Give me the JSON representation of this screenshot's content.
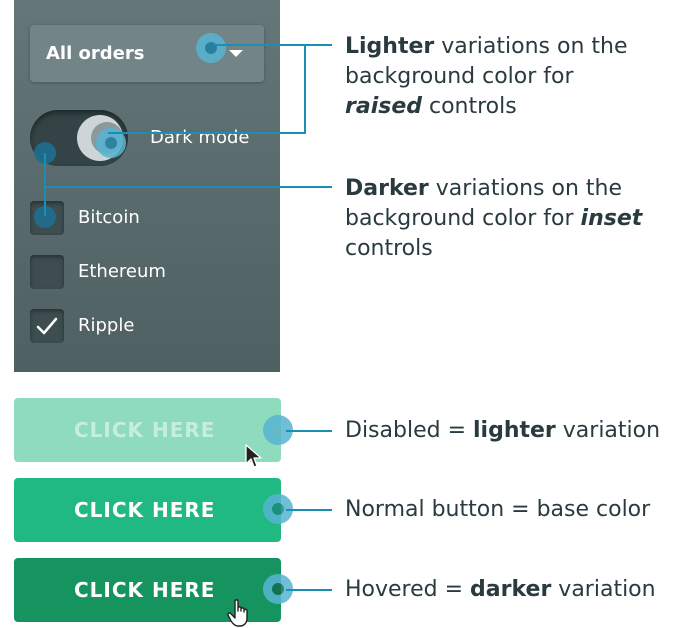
{
  "panel": {
    "dropdown_label": "All orders",
    "toggle_label": "Dark mode",
    "checkboxes": [
      {
        "label": "Bitcoin",
        "checked": false
      },
      {
        "label": "Ethereum",
        "checked": false
      },
      {
        "label": "Ripple",
        "checked": true
      }
    ]
  },
  "annotations": {
    "lighter": {
      "bold": "Lighter",
      "line1_rest": " variations on the",
      "line2": "background color for",
      "line3_em": "raised",
      "line3_rest": " controls"
    },
    "darker": {
      "bold": "Darker",
      "line1_rest": " variations on the",
      "line2_pre": "background color for ",
      "line2_em": "inset",
      "line3": "controls"
    }
  },
  "buttons": [
    {
      "label": "CLICK HERE",
      "state": "disabled",
      "note_pre": "Disabled = ",
      "note_bold": "lighter",
      "note_post": " variation"
    },
    {
      "label": "CLICK HERE",
      "state": "normal",
      "note_pre": "Normal button = base color",
      "note_bold": "",
      "note_post": ""
    },
    {
      "label": "CLICK HERE",
      "state": "hover",
      "note_pre": "Hovered = ",
      "note_bold": "darker",
      "note_post": " variation"
    }
  ],
  "colors": {
    "panel_bg": "#5a6b6d",
    "raised_control": "#728486",
    "inset_control": "#3e4e50",
    "annotation_line": "#1c8eb6",
    "button_disabled": "#8edbbe",
    "button_normal": "#20b981",
    "button_hover": "#169460",
    "text": "#2a3b3f"
  },
  "icons": [
    "chevron-down-icon",
    "moon-icon",
    "checkmark-icon",
    "arrow-cursor-icon",
    "hand-cursor-icon"
  ]
}
